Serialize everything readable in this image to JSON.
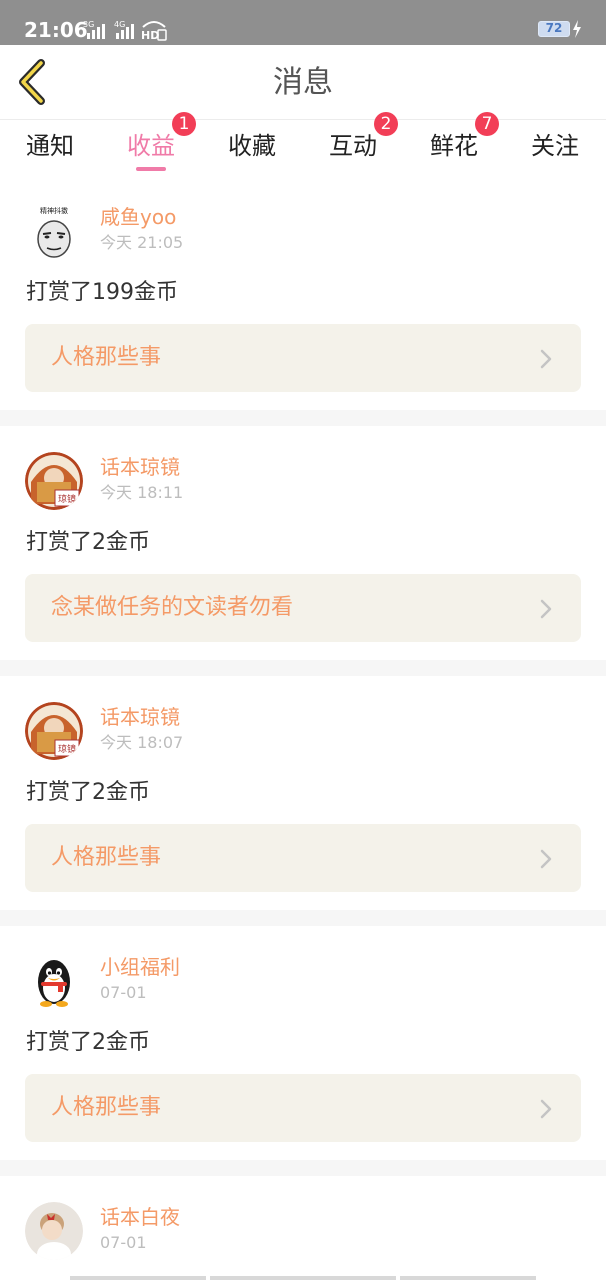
{
  "status_bar": {
    "time": "21:06",
    "network_1": "3G",
    "network_2": "4G",
    "hd_label": "HD",
    "battery": "72",
    "icons": [
      "signal-icon",
      "signal-icon",
      "hd-icon",
      "charging-icon"
    ]
  },
  "header": {
    "title": "消息",
    "back_icon": "chevron-left-icon"
  },
  "tabs": [
    {
      "label": "通知"
    },
    {
      "label": "收益",
      "badge": "1"
    },
    {
      "label": "收藏"
    },
    {
      "label": "互动",
      "badge": "2"
    },
    {
      "label": "鲜花",
      "badge": "7"
    },
    {
      "label": "关注"
    }
  ],
  "active_tab": "收益",
  "colors": {
    "accent": "#f07ba8",
    "badge": "#f23e57",
    "username": "#f49a67",
    "ref_bg": "#f4f2ea"
  },
  "feed": [
    {
      "username": "咸鱼yoo",
      "time": "今天 21:05",
      "action": "打赏了199金币",
      "ref_title": "人格那些事",
      "avatar_caption": "精神抖擞",
      "avatar": "meme-face-avatar"
    },
    {
      "username": "话本琼镜",
      "time": "今天 18:11",
      "action": "打赏了2金币",
      "ref_title": "念某做任务的文读者勿看",
      "avatar_badge": "琼镜",
      "avatar": "illustrated-avatar"
    },
    {
      "username": "话本琼镜",
      "time": "今天 18:07",
      "action": "打赏了2金币",
      "ref_title": "人格那些事",
      "avatar_badge": "琼镜",
      "avatar": "illustrated-avatar"
    },
    {
      "username": "小组福利",
      "time": "07-01",
      "action": "打赏了2金币",
      "ref_title": "人格那些事",
      "avatar": "penguin-avatar"
    },
    {
      "username": "话本白夜",
      "time": "07-01",
      "avatar": "photo-avatar"
    }
  ]
}
